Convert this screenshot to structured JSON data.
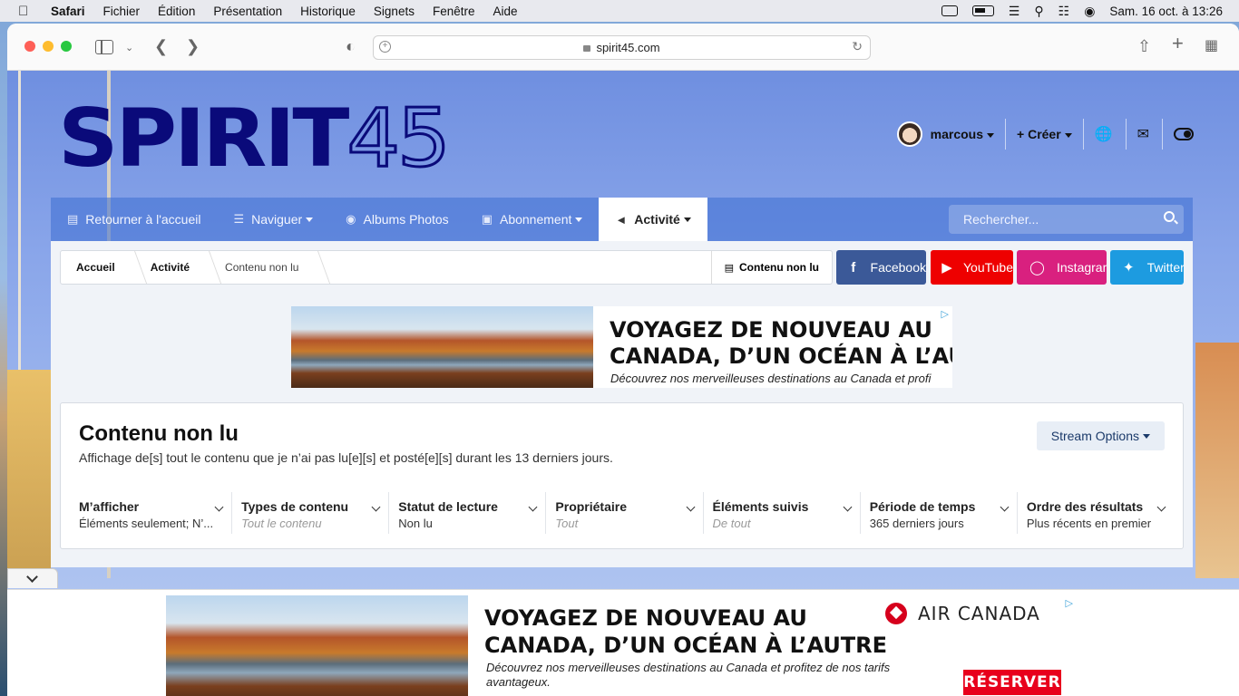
{
  "menubar": {
    "app": "Safari",
    "items": [
      "Fichier",
      "Édition",
      "Présentation",
      "Historique",
      "Signets",
      "Fenêtre",
      "Aide"
    ],
    "datetime": "Sam. 16 oct. à  13:26"
  },
  "browser": {
    "url": "spirit45.com"
  },
  "site": {
    "logo_text_a": "SPIRIT",
    "logo_text_b": "45",
    "user": "marcous",
    "create_label": "Créer"
  },
  "nav": {
    "items": [
      {
        "label": "Retourner à l'accueil",
        "icon": "document-icon"
      },
      {
        "label": "Naviguer",
        "icon": "list-icon"
      },
      {
        "label": "Albums Photos",
        "icon": "camera-icon"
      },
      {
        "label": "Abonnement",
        "icon": "cart-icon"
      },
      {
        "label": "Activité",
        "icon": "megaphone-icon"
      }
    ],
    "search_placeholder": "Rechercher..."
  },
  "breadcrumb": {
    "items": [
      "Accueil",
      "Activité",
      "Contenu non lu"
    ],
    "right_label": "Contenu non lu"
  },
  "social": {
    "facebook": "Facebook",
    "youtube": "YouTube",
    "instagram": "Instagram",
    "twitter": "Twitter"
  },
  "ad": {
    "headline_line1": "VOYAGEZ DE NOUVEAU AU",
    "headline_line2": "CANADA, D’UN OCÉAN À L’AUTRE",
    "top_headline_line2": "CANADA, D’UN OCÉAN À L’AUT",
    "top_sub": "Découvrez nos merveilleuses destinations au Canada et profi",
    "sub": "Découvrez nos merveilleuses destinations au Canada et profitez de nos tarifs avantageux.",
    "brand": "AIR CANADA",
    "cta": "RÉSERVER"
  },
  "panel": {
    "title": "Contenu non lu",
    "description": "Affichage de[s] tout le contenu que je n’ai pas lu[e][s] et posté[e][s] durant les 13 derniers jours.",
    "stream_options": "Stream Options",
    "filters": [
      {
        "label": "M’afficher",
        "value": "Éléments seulement; N’..."
      },
      {
        "label": "Types de contenu",
        "value": "Tout le contenu"
      },
      {
        "label": "Statut de lecture",
        "value": "Non lu"
      },
      {
        "label": "Propriétaire",
        "value": "Tout"
      },
      {
        "label": "Éléments suivis",
        "value": "De tout"
      },
      {
        "label": "Période de temps",
        "value": "365 derniers jours"
      },
      {
        "label": "Ordre des résultats",
        "value": "Plus récents en premier"
      }
    ]
  }
}
